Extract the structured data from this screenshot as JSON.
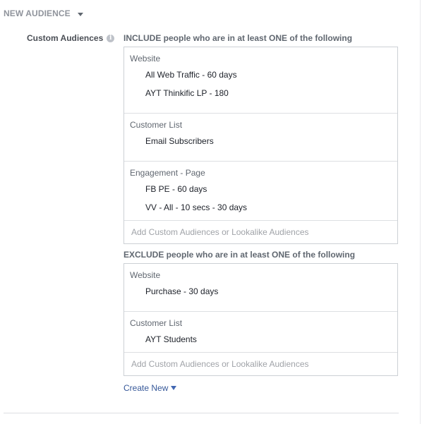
{
  "header": {
    "title": "NEW AUDIENCE"
  },
  "custom_audiences": {
    "label": "Custom Audiences",
    "include": {
      "title": "INCLUDE people who are in at least ONE of the following",
      "groups": [
        {
          "name": "Website",
          "items": [
            "All Web Traffic - 60 days",
            "AYT Thinkific LP - 180"
          ]
        },
        {
          "name": "Customer List",
          "items": [
            "Email Subscribers"
          ]
        },
        {
          "name": "Engagement - Page",
          "items": [
            "FB PE - 60 days",
            "VV - All - 10 secs - 30 days"
          ]
        }
      ],
      "add_placeholder": "Add Custom Audiences or Lookalike Audiences"
    },
    "exclude": {
      "title": "EXCLUDE people who are in at least ONE of the following",
      "groups": [
        {
          "name": "Website",
          "items": [
            "Purchase - 30 days"
          ]
        },
        {
          "name": "Customer List",
          "items": [
            "AYT Students"
          ]
        }
      ],
      "add_placeholder": "Add Custom Audiences or Lookalike Audiences"
    },
    "create_new": "Create New"
  }
}
